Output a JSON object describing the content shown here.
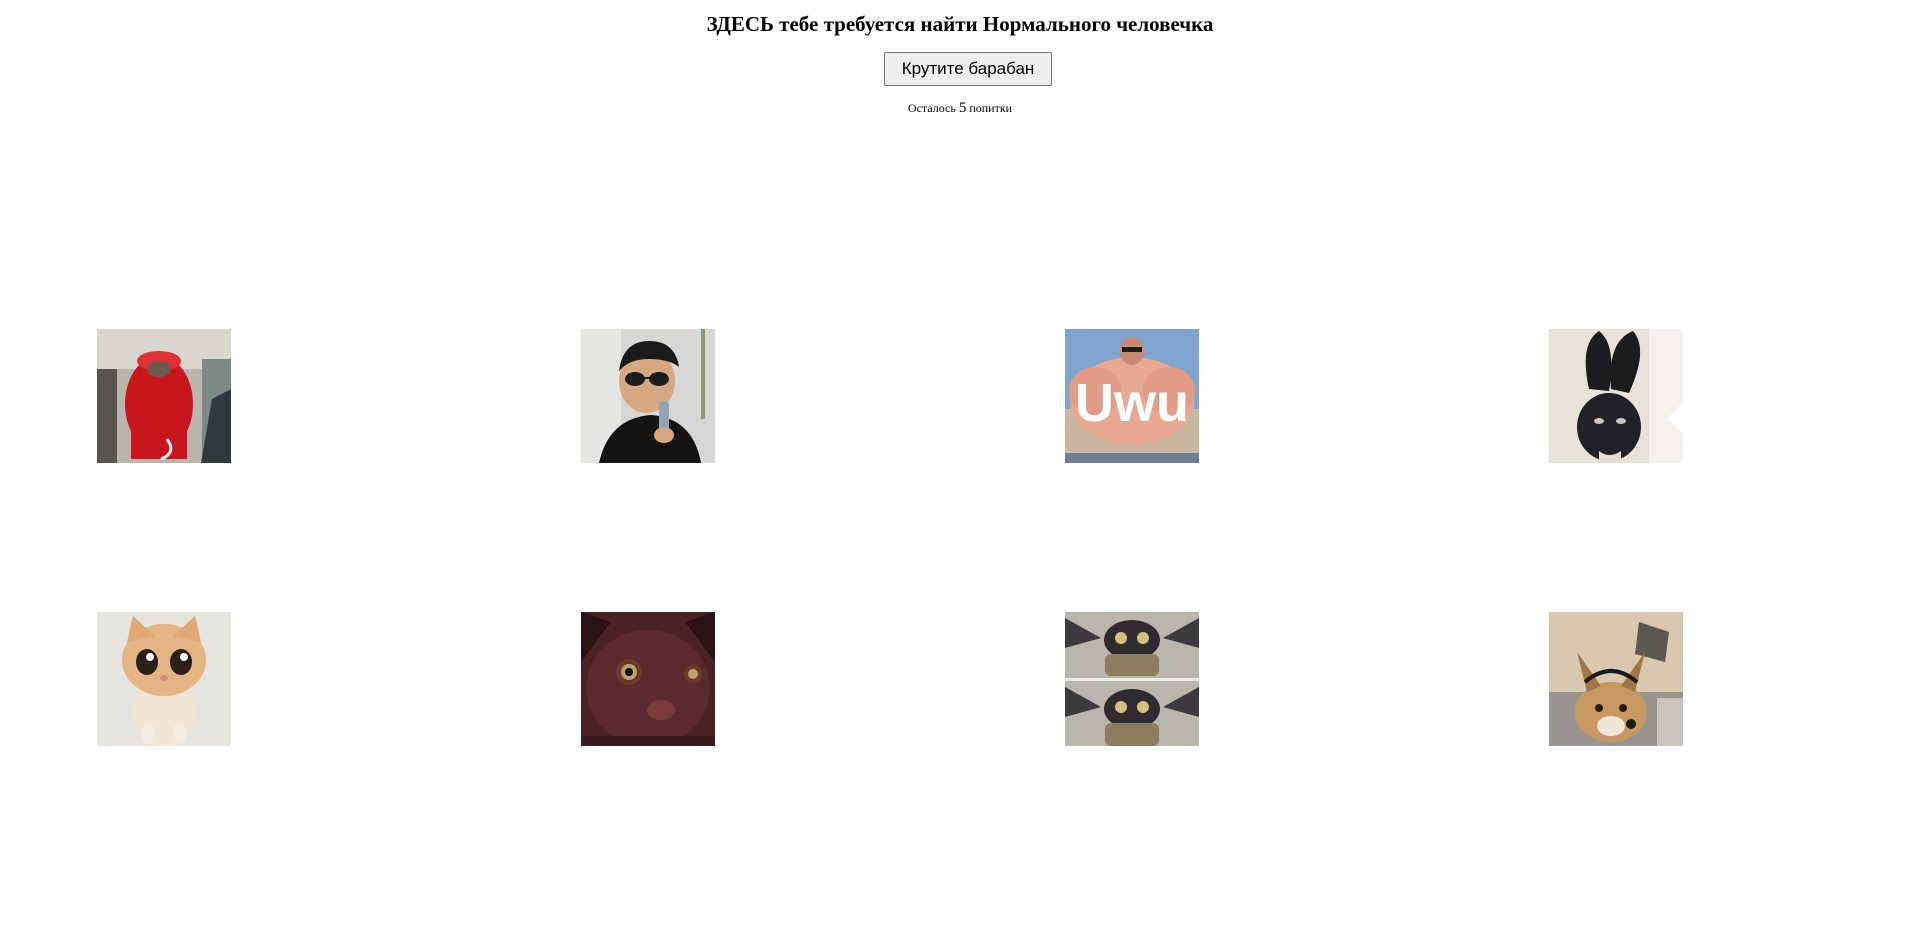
{
  "header": {
    "title": "ЗДЕСЬ тебе требуется найти Нормального человечка"
  },
  "controls": {
    "spin_label": "Крутите барабан"
  },
  "status": {
    "prefix": "Осталось",
    "count": "5",
    "suffix": "попитки"
  },
  "grid": {
    "tiles": [
      {
        "icon": "red-crewmate-costume-image",
        "caption": ""
      },
      {
        "icon": "boy-with-sunglasses-microphone-image",
        "caption": ""
      },
      {
        "icon": "muscular-man-uwu-image",
        "caption": "Uwu"
      },
      {
        "icon": "black-bunny-mask-image",
        "caption": ""
      },
      {
        "icon": "crying-kitten-image",
        "caption": ""
      },
      {
        "icon": "dark-cat-closeup-image",
        "caption": ""
      },
      {
        "icon": "cat-in-yoda-costume-image",
        "caption": ""
      },
      {
        "icon": "caracal-with-headset-image",
        "caption": ""
      }
    ]
  }
}
